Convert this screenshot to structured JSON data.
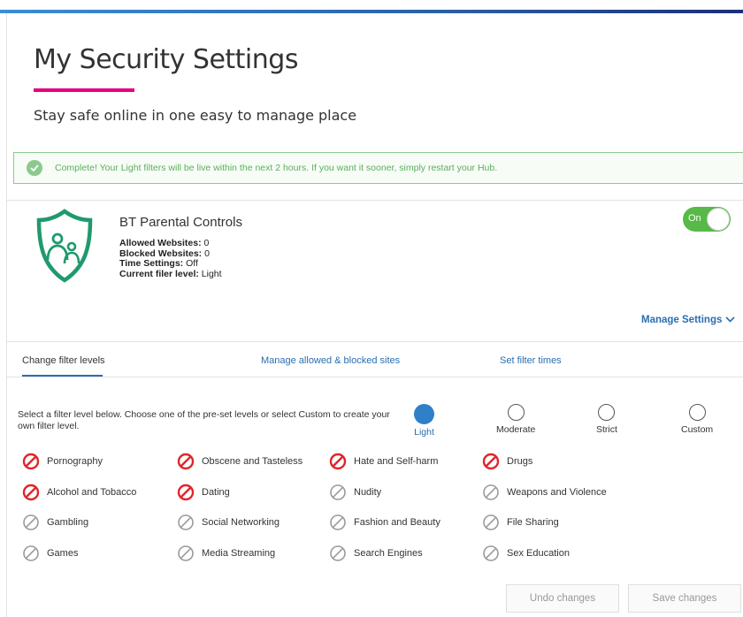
{
  "header": {
    "title": "My Security Settings",
    "subtitle": "Stay safe online in one easy to manage place",
    "accent_color": "#e6007e"
  },
  "banner": {
    "message": "Complete! Your Light filters will be live within the next 2 hours. If you want it sooner, simply restart your Hub.",
    "icon": "check-circle-icon",
    "color": "#5cae5c"
  },
  "parental_controls": {
    "title": "BT Parental Controls",
    "icon": "shield-family-icon",
    "stats": [
      {
        "label": "Allowed Websites:",
        "value": " 0"
      },
      {
        "label": "Blocked Websites:",
        "value": " 0"
      },
      {
        "label": "Time Settings:",
        "value": " Off"
      },
      {
        "label": "Current filer level:",
        "value": " Light"
      }
    ],
    "toggle": {
      "label": "On",
      "state": "on",
      "color": "#57b947"
    },
    "manage_settings": "Manage Settings"
  },
  "tabs": [
    {
      "label": "Change filter levels",
      "active": true
    },
    {
      "label": "Manage allowed & blocked sites",
      "active": false
    },
    {
      "label": "Set filter times",
      "active": false
    }
  ],
  "filter": {
    "instructions": "Select a filter level below. Choose one of the pre-set levels or select Custom to create your own filter level.",
    "levels": [
      {
        "name": "Light",
        "selected": true
      },
      {
        "name": "Moderate",
        "selected": false
      },
      {
        "name": "Strict",
        "selected": false
      },
      {
        "name": "Custom",
        "selected": false
      }
    ]
  },
  "categories": [
    {
      "label": "Pornography",
      "blocked": true
    },
    {
      "label": "Obscene and Tasteless",
      "blocked": true
    },
    {
      "label": "Hate and Self-harm",
      "blocked": true
    },
    {
      "label": "Drugs",
      "blocked": true
    },
    {
      "label": "Alcohol and Tobacco",
      "blocked": true
    },
    {
      "label": "Dating",
      "blocked": true
    },
    {
      "label": "Nudity",
      "blocked": false
    },
    {
      "label": "Weapons and Violence",
      "blocked": false
    },
    {
      "label": "Gambling",
      "blocked": false
    },
    {
      "label": "Social Networking",
      "blocked": false
    },
    {
      "label": "Fashion and Beauty",
      "blocked": false
    },
    {
      "label": "File Sharing",
      "blocked": false
    },
    {
      "label": "Games",
      "blocked": false
    },
    {
      "label": "Media Streaming",
      "blocked": false
    },
    {
      "label": "Search Engines",
      "blocked": false
    },
    {
      "label": "Sex Education",
      "blocked": false
    }
  ],
  "buttons": {
    "undo": "Undo changes",
    "save": "Save changes"
  },
  "colors": {
    "primary": "#2a6eb0",
    "blocked": "#e0262b",
    "allowed": "#9a9a9a"
  }
}
